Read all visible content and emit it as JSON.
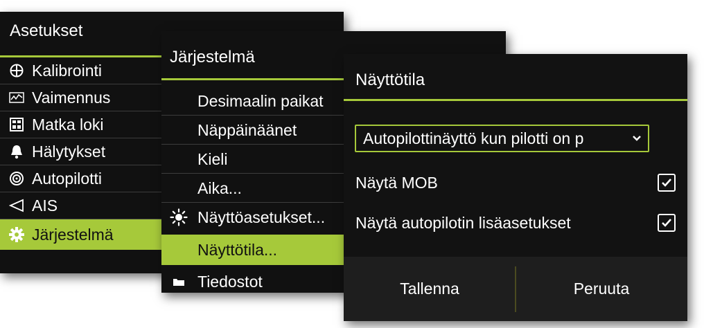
{
  "settings_panel": {
    "title": "Asetukset",
    "items": [
      {
        "label": "Kalibrointi",
        "icon": "calibration-icon"
      },
      {
        "label": "Vaimennus",
        "icon": "damping-icon"
      },
      {
        "label": "Matka loki",
        "icon": "trip-log-icon"
      },
      {
        "label": "Hälytykset",
        "icon": "bell-icon"
      },
      {
        "label": "Autopilotti",
        "icon": "autopilot-icon"
      },
      {
        "label": "AIS",
        "icon": "ais-icon"
      },
      {
        "label": "Järjestelmä",
        "icon": "gear-icon",
        "selected": true
      }
    ]
  },
  "system_panel": {
    "title": "Järjestelmä",
    "items": [
      {
        "label": "Desimaalin paikat"
      },
      {
        "label": "Näppäinäänet"
      },
      {
        "label": "Kieli"
      },
      {
        "label": "Aika..."
      },
      {
        "label": "Näyttöasetukset...",
        "icon": "brightness-icon"
      },
      {
        "label": "Näyttötila...",
        "selected": true
      },
      {
        "label": "Tiedostot",
        "icon": "folder-icon"
      }
    ]
  },
  "mode_dialog": {
    "title": "Näyttötila",
    "dropdown_value": "Autopilottinäyttö kun pilotti on p",
    "options": [
      {
        "label": "Näytä MOB",
        "checked": true
      },
      {
        "label": "Näytä autopilotin lisäasetukset",
        "checked": true
      }
    ],
    "save_label": "Tallenna",
    "cancel_label": "Peruuta"
  },
  "colors": {
    "accent": "#a6c93a",
    "panel_bg": "#111111",
    "text": "#ffffff"
  }
}
